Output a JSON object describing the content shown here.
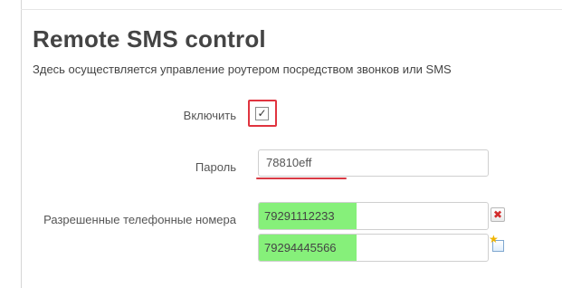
{
  "page": {
    "title": "Remote SMS control",
    "subtitle": "Здесь осуществляется управление роутером посредством звонков или SMS"
  },
  "form": {
    "enable": {
      "label": "Включить",
      "checked": true
    },
    "password": {
      "label": "Пароль",
      "value": "78810eff"
    },
    "phones": {
      "label": "Разрешенные телефонные номера",
      "values": [
        "79291112233",
        "79294445566"
      ]
    }
  },
  "colors": {
    "highlight_red": "#e0343f",
    "highlight_green": "#86f07a"
  },
  "icons": {
    "checkmark": "✓",
    "remove": "✖",
    "add": "★"
  }
}
